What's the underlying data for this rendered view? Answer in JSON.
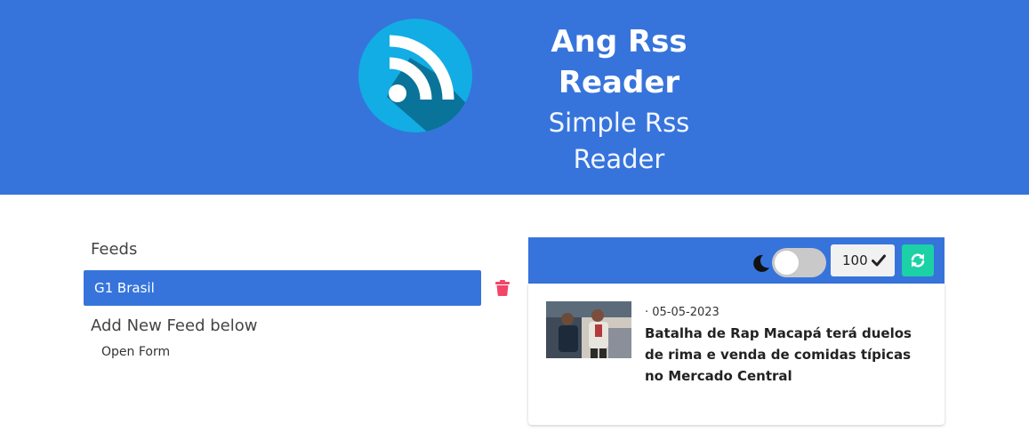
{
  "header": {
    "title_line1": "Ang Rss",
    "title_line2": "Reader",
    "subtitle_line1": "Simple Rss",
    "subtitle_line2": "Reader",
    "logo_icon": "rss-icon",
    "color": "#3674dc"
  },
  "sidebar": {
    "feeds_heading": "Feeds",
    "feeds": [
      {
        "label": "G1 Brasil",
        "selected": true
      }
    ],
    "add_heading": "Add New Feed below",
    "open_form_label": "Open Form"
  },
  "toolbar": {
    "dark_mode_icon": "moon-icon",
    "dark_mode_on": false,
    "count_value": "100",
    "confirm_icon": "check-icon",
    "refresh_icon": "refresh-icon",
    "refresh_color": "#1bd1a5"
  },
  "articles": [
    {
      "date": "· 05-05-2023",
      "title": "Batalha de Rap Macapá terá duelos de rima e venda de comidas típicas no Mercado Central"
    }
  ],
  "colors": {
    "primary": "#3674dc",
    "danger": "#f14668",
    "accent": "#1bd1a5"
  }
}
